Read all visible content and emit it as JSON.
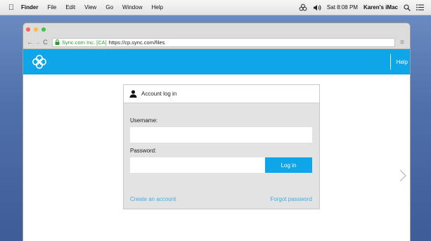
{
  "menubar": {
    "app": "Finder",
    "items": [
      "File",
      "Edit",
      "View",
      "Go",
      "Window",
      "Help"
    ],
    "clock": "Sat 8:08 PM",
    "user": "Karen's iMac"
  },
  "browser": {
    "org": "Sync.com Inc. [CA]",
    "url": "https://cp.sync.com/files"
  },
  "app": {
    "help_label": "Help"
  },
  "login": {
    "title": "Account log in",
    "username_label": "Username:",
    "password_label": "Password:",
    "button": "Log in",
    "create_account": "Create an account",
    "forgot_password": "Forgot password"
  },
  "colors": {
    "accent": "#0ea6e9",
    "link": "#3aaee8",
    "secure": "#2e9b2e"
  }
}
